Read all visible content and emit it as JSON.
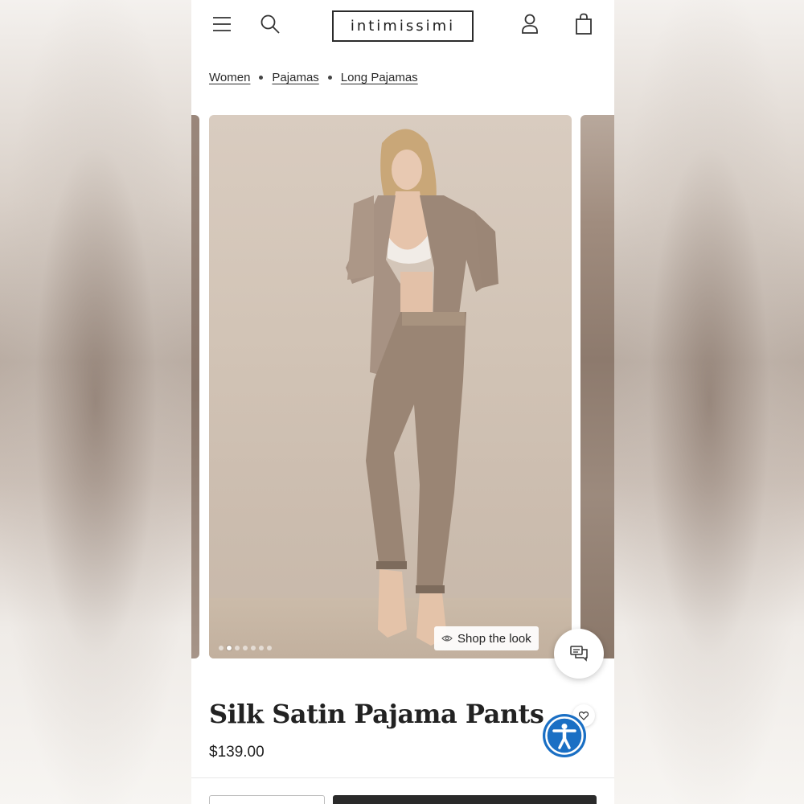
{
  "header": {
    "logo_text": "intimissimi",
    "icons": [
      "menu-icon",
      "search-icon",
      "account-icon",
      "shopping-bag-icon"
    ]
  },
  "breadcrumb": {
    "items": [
      "Women",
      "Pajamas",
      "Long Pajamas"
    ]
  },
  "gallery": {
    "slide_count": 7,
    "active_slide": 2,
    "shop_the_look_label": "Shop the look"
  },
  "product": {
    "title": "Silk Satin Pajama Pants",
    "price": "$139.00"
  },
  "colors": {
    "accessibility_blue": "#1a6fc4",
    "text_dark": "#222222",
    "add_to_bag_bg": "#2a2a2a"
  }
}
